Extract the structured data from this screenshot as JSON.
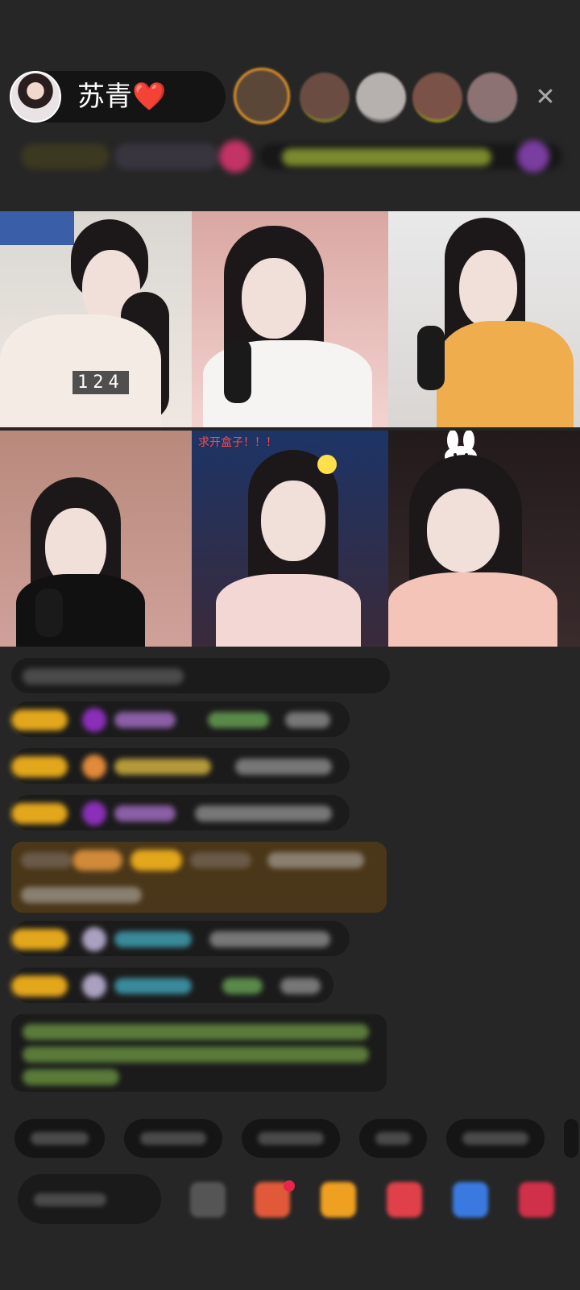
{
  "host": {
    "name": "苏青❤️"
  },
  "tiles": [
    {
      "badge": "124"
    },
    {},
    {},
    {},
    {
      "caption": "求开盒子！！！"
    },
    {}
  ],
  "colors": {
    "background": "#262626",
    "gift_gold": "#e3a71c",
    "viewer_ring": "#e3952a",
    "notification_dot": "#e8254a"
  },
  "icons": [
    "close-icon",
    "bunny-ears-icon",
    "emoji-icon",
    "gift-icon",
    "game-icon",
    "shop-icon",
    "more-icon"
  ]
}
